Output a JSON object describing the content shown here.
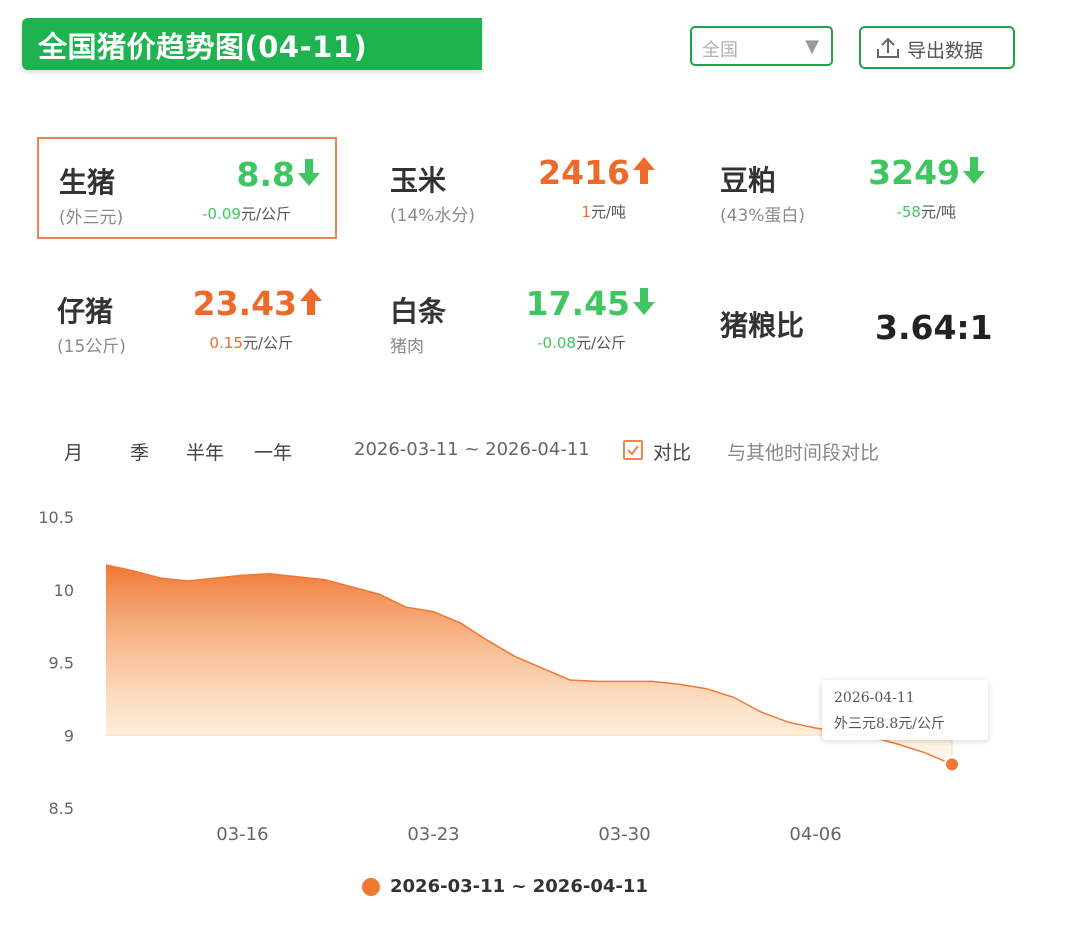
{
  "header": {
    "title": "全国猪价趋势图(04-11)"
  },
  "region_select": {
    "value": "全国"
  },
  "export_button": {
    "label": "导出数据"
  },
  "cards": [
    {
      "name": "生猪",
      "sub": "(外三元)",
      "price": "8.8",
      "trend": "down",
      "change": "-0.09",
      "unit": "元/公斤"
    },
    {
      "name": "玉米",
      "sub": "(14%水分)",
      "price": "2416",
      "trend": "up",
      "change": "1",
      "unit": "元/吨"
    },
    {
      "name": "豆粕",
      "sub": "(43%蛋白)",
      "price": "3249",
      "trend": "down",
      "change": "-58",
      "unit": "元/吨"
    },
    {
      "name": "仔猪",
      "sub": "(15公斤)",
      "price": "23.43",
      "trend": "up",
      "change": "0.15",
      "unit": "元/公斤"
    },
    {
      "name": "白条",
      "sub": "猪肉",
      "price": "17.45",
      "trend": "down",
      "change": "-0.08",
      "unit": "元/公斤"
    }
  ],
  "ratio": {
    "name": "猪粮比",
    "value": "3.64:1"
  },
  "period_tabs": [
    "月",
    "季",
    "半年",
    "一年"
  ],
  "date_range": "2026-03-11 ~ 2026-04-11",
  "compare": {
    "label": "对比",
    "other_label": "与其他时间段对比",
    "checked": true
  },
  "tooltip": {
    "date": "2026-04-11",
    "text": "外三元8.8元/公斤"
  },
  "legend": {
    "label": "2026-03-11 ~ 2026-04-11"
  },
  "colors": {
    "brand_green": "#1fb350",
    "up": "#ee6a2a",
    "down": "#3fc661",
    "series": "#f07835"
  },
  "chart_data": {
    "type": "area",
    "ylim": [
      8.5,
      10.5
    ],
    "yticks": [
      "10.5",
      "10",
      "9.5",
      "9",
      "8.5"
    ],
    "xticks": [
      "03-16",
      "03-23",
      "03-30",
      "04-06"
    ],
    "x": [
      "03-11",
      "03-12",
      "03-13",
      "03-14",
      "03-15",
      "03-16",
      "03-17",
      "03-18",
      "03-19",
      "03-20",
      "03-21",
      "03-22",
      "03-23",
      "03-24",
      "03-25",
      "03-26",
      "03-27",
      "03-28",
      "03-29",
      "03-30",
      "03-31",
      "04-01",
      "04-02",
      "04-03",
      "04-04",
      "04-05",
      "04-06",
      "04-07",
      "04-08",
      "04-09",
      "04-10",
      "04-11"
    ],
    "series": [
      {
        "values": [
          10.17,
          10.13,
          10.08,
          10.06,
          10.08,
          10.1,
          10.11,
          10.09,
          10.07,
          10.02,
          9.97,
          9.88,
          9.85,
          9.77,
          9.65,
          9.54,
          9.46,
          9.38,
          9.37,
          9.37,
          9.37,
          9.35,
          9.32,
          9.26,
          9.16,
          9.09,
          9.05,
          9.02,
          8.99,
          8.94,
          8.88,
          8.8
        ]
      }
    ]
  }
}
